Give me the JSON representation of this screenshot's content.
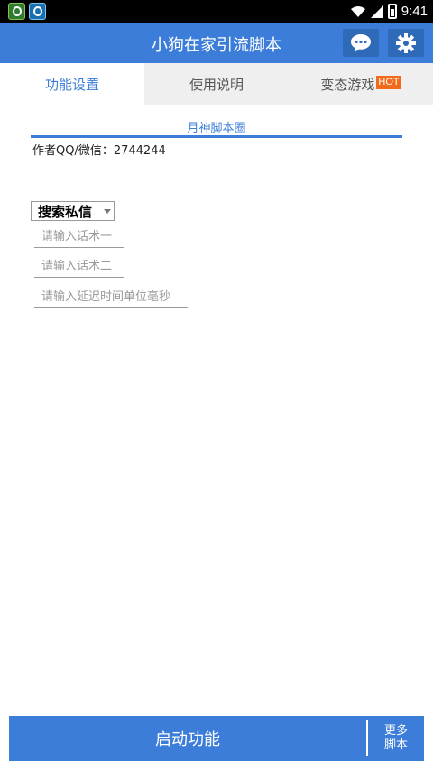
{
  "status_bar": {
    "time": "9:41",
    "left_icons": [
      "app-notification-icon",
      "browser-notification-icon"
    ],
    "right_icons": [
      "wifi-icon",
      "signal-icon",
      "battery-icon"
    ]
  },
  "header": {
    "title": "小狗在家引流脚本",
    "chat_icon": "chat-bubble-icon",
    "settings_icon": "gear-icon",
    "color": "#3b7dd8"
  },
  "tabs": [
    {
      "label": "功能设置",
      "active": true
    },
    {
      "label": "使用说明",
      "active": false
    },
    {
      "label": "变态游戏",
      "badge": "HOT",
      "active": false
    }
  ],
  "main": {
    "link_title": "月神脚本圈",
    "author": "作者QQ/微信：2744244",
    "mode_select": {
      "value": "搜索私信"
    },
    "inputs": [
      {
        "placeholder": "请输入话术一",
        "value": ""
      },
      {
        "placeholder": "请输入话术二",
        "value": ""
      },
      {
        "placeholder": "请输入延迟时间单位毫秒",
        "value": ""
      }
    ]
  },
  "footer": {
    "start_label": "启动功能",
    "more_line1": "更多",
    "more_line2": "脚本"
  },
  "colors": {
    "accent": "#3b7dd8",
    "hot": "#f26a1b",
    "tab_bg": "#efefef"
  }
}
